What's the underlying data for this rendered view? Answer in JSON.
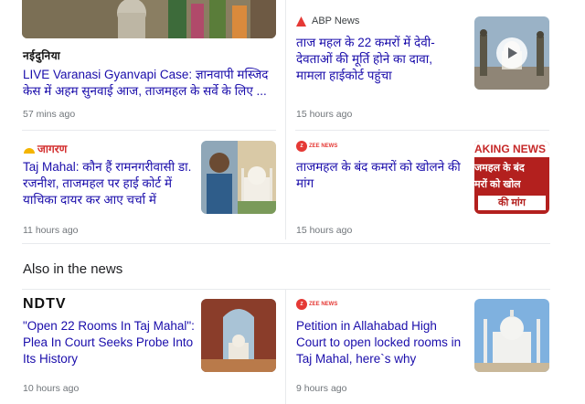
{
  "cards": [
    {
      "id": "naidunia",
      "source": "नईदुनिया",
      "title": "LIVE Varanasi Gyanvapi Case: ज्ञानवापी मस्जिद केस में अहम सुनवाई आज, ताजमहल के सर्वे के लिए ...",
      "time": "57 mins ago"
    },
    {
      "id": "abp",
      "source": "ABP News",
      "title": "ताज महल के 22 कमरों में देवी-देवताओं की मूर्ति होने का दावा, मामला हाईकोर्ट पहुंचा",
      "time": "15 hours ago"
    },
    {
      "id": "jagran",
      "source": "जागरण",
      "title": "Taj Mahal: कौन हैं रामनगरीवासी डा. रजनीश, ताजमहल पर हाई कोर्ट में याचिका दायर कर आए चर्चा में",
      "time": "11 hours ago"
    },
    {
      "id": "zee1",
      "source": "ZEE NEWS",
      "title": "ताजमहल के बंद कमरों को खोलने की मांग",
      "time": "15 hours ago",
      "thumb_text": [
        "AKING NEWS",
        "जमहल के बंद",
        "मरों को खोल",
        "की मांग"
      ]
    },
    {
      "id": "ndtv",
      "source": "NDTV",
      "title": "\"Open 22 Rooms In Taj Mahal\": Plea In Court Seeks Probe Into Its History",
      "time": "10 hours ago"
    },
    {
      "id": "zee2",
      "source": "ZEE NEWS",
      "title": "Petition in Allahabad High Court to open locked rooms in Taj Mahal, here`s why",
      "time": "9 hours ago"
    }
  ],
  "section": {
    "also_in_news": "Also in the news"
  },
  "colors": {
    "link": "#1a0dab",
    "meta": "#70757a",
    "divider": "#e8eaed"
  }
}
